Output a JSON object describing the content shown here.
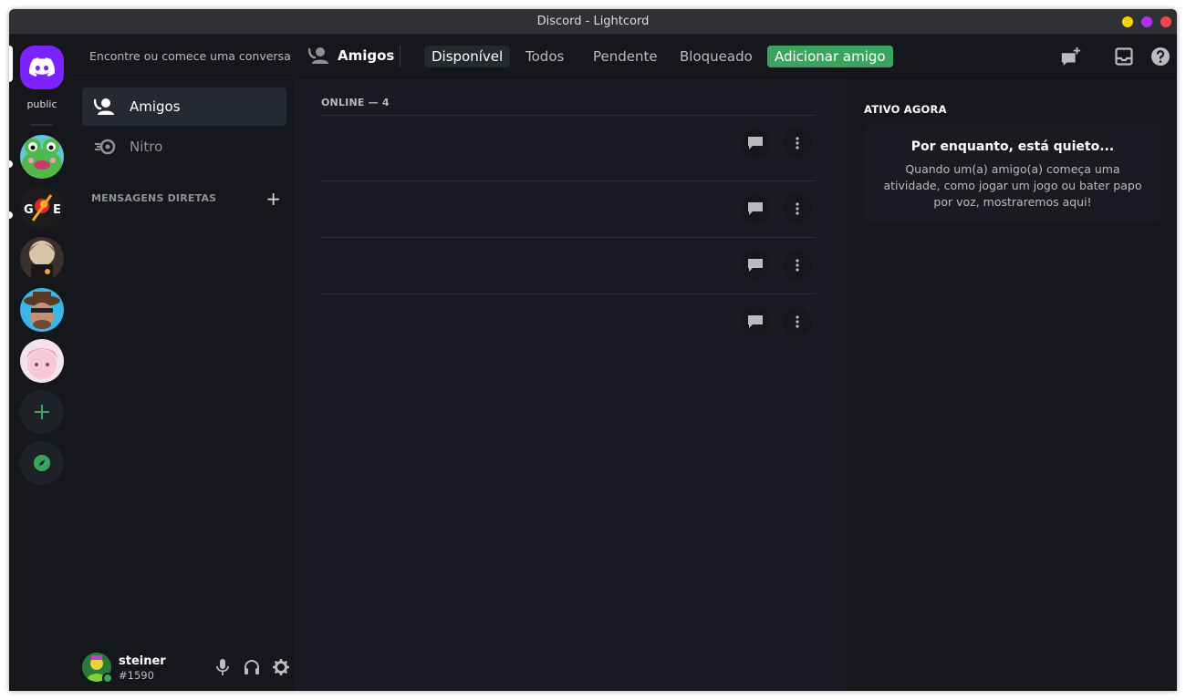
{
  "window": {
    "title": "Discord - Lightcord"
  },
  "guilds": {
    "home_label": "public",
    "servers": [
      {
        "name": "frog-server"
      },
      {
        "name": "ge-server"
      },
      {
        "name": "anime-server"
      },
      {
        "name": "cowboy-server"
      },
      {
        "name": "pink-server"
      }
    ]
  },
  "sidebar": {
    "search_placeholder": "Encontre ou comece uma conversa",
    "nav": [
      {
        "label": "Amigos"
      },
      {
        "label": "Nitro"
      }
    ],
    "dm_header": "MENSAGENS DIRETAS",
    "dm_add": "+"
  },
  "user": {
    "name": "steiner",
    "tag": "#1590"
  },
  "topbar": {
    "title": "Amigos",
    "tabs": {
      "online": "Disponível",
      "all": "Todos",
      "pending": "Pendente",
      "blocked": "Bloqueado",
      "add": "Adicionar amigo"
    }
  },
  "friends": {
    "header": "ONLINE — 4"
  },
  "active_now": {
    "title": "ATIVO AGORA",
    "heading": "Por enquanto, está quieto...",
    "body": "Quando um(a) amigo(a) começa uma atividade, como jogar um jogo ou bater papo por voz, mostraremos aqui!"
  },
  "colors": {
    "accent": "#7c22ff",
    "green": "#3ba55d",
    "background": "#16171d"
  }
}
